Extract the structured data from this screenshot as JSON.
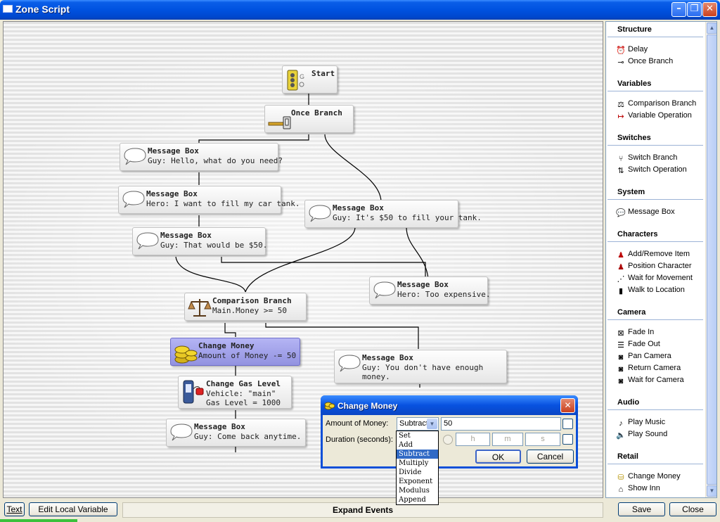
{
  "window": {
    "title": "Zone Script",
    "controls": [
      "minimize-icon",
      "restore-icon",
      "close-icon"
    ]
  },
  "nodes": [
    {
      "id": "start",
      "title": "Start",
      "desc": "",
      "icon": "traffic-light-icon"
    },
    {
      "id": "once",
      "title": "Once Branch",
      "desc": "",
      "icon": "key-icon"
    },
    {
      "id": "msg1",
      "title": "Message Box",
      "desc": "Guy: Hello, what do you need?",
      "icon": "speech-bubble-icon"
    },
    {
      "id": "msg2",
      "title": "Message Box",
      "desc": "Hero: I want to fill my car tank.",
      "icon": "speech-bubble-icon"
    },
    {
      "id": "msg3",
      "title": "Message Box",
      "desc": "Guy: That would be $50.",
      "icon": "speech-bubble-icon"
    },
    {
      "id": "msg4",
      "title": "Message Box",
      "desc": "Guy: It's $50 to fill your tank.",
      "icon": "speech-bubble-icon"
    },
    {
      "id": "msg5",
      "title": "Message Box",
      "desc": "Hero: Too expensive.",
      "icon": "speech-bubble-icon"
    },
    {
      "id": "cmp",
      "title": "Comparison Branch",
      "desc": "Main.Money >= 50",
      "icon": "scale-icon"
    },
    {
      "id": "money",
      "title": "Change Money",
      "desc": "Amount of Money -= 50",
      "icon": "coins-icon"
    },
    {
      "id": "gas",
      "title": "Change Gas Level",
      "desc": "Vehicle: \"main\"\nGas Level = 1000",
      "icon": "gas-pump-icon"
    },
    {
      "id": "msg6",
      "title": "Message Box",
      "desc": "Guy: Come back anytime.",
      "icon": "speech-bubble-icon"
    },
    {
      "id": "msg7",
      "title": "Message Box",
      "desc": "Guy: You don't have enough\nmoney.",
      "icon": "speech-bubble-icon"
    }
  ],
  "panel": {
    "sections": [
      {
        "header": "Structure",
        "items": [
          {
            "label": "Delay",
            "icon": "alarm-clock-icon"
          },
          {
            "label": "Once Branch",
            "icon": "key-icon"
          }
        ]
      },
      {
        "header": "Variables",
        "items": [
          {
            "label": "Comparison Branch",
            "icon": "scale-icon"
          },
          {
            "label": "Variable Operation",
            "icon": "arrow-operation-icon"
          }
        ]
      },
      {
        "header": "Switches",
        "items": [
          {
            "label": "Switch Branch",
            "icon": "switch-branch-icon"
          },
          {
            "label": "Switch Operation",
            "icon": "switch-operation-icon"
          }
        ]
      },
      {
        "header": "System",
        "items": [
          {
            "label": "Message Box",
            "icon": "speech-bubble-icon"
          }
        ]
      },
      {
        "header": "Characters",
        "items": [
          {
            "label": "Add/Remove Item",
            "icon": "add-remove-item-icon"
          },
          {
            "label": "Position Character",
            "icon": "position-character-icon"
          },
          {
            "label": "Wait for Movement",
            "icon": "wait-movement-icon"
          },
          {
            "label": "Walk to Location",
            "icon": "walk-location-icon"
          }
        ]
      },
      {
        "header": "Camera",
        "items": [
          {
            "label": "Fade In",
            "icon": "fade-in-icon"
          },
          {
            "label": "Fade Out",
            "icon": "fade-out-icon"
          },
          {
            "label": "Pan Camera",
            "icon": "pan-camera-icon"
          },
          {
            "label": "Return Camera",
            "icon": "return-camera-icon"
          },
          {
            "label": "Wait for Camera",
            "icon": "wait-camera-icon"
          }
        ]
      },
      {
        "header": "Audio",
        "items": [
          {
            "label": "Play Music",
            "icon": "music-note-icon"
          },
          {
            "label": "Play Sound",
            "icon": "speaker-icon"
          }
        ]
      },
      {
        "header": "Retail",
        "items": [
          {
            "label": "Change Money",
            "icon": "coins-icon"
          },
          {
            "label": "Show Inn",
            "icon": "inn-icon"
          }
        ]
      }
    ]
  },
  "bottom": {
    "text_btn": "Text",
    "edit_var": "Edit Local Variable",
    "expand": "Expand Events",
    "save": "Save",
    "close": "Close"
  },
  "dialog": {
    "title": "Change Money",
    "amount_label": "Amount of Money:",
    "operation": "Subtract",
    "amount_value": "50",
    "duration_label": "Duration (seconds):",
    "h": "h",
    "m": "m",
    "s": "s",
    "ok": "OK",
    "cancel": "Cancel",
    "options": [
      "Set",
      "Add",
      "Subtract",
      "Multiply",
      "Divide",
      "Exponent",
      "Modulus",
      "Append"
    ],
    "selected_option": "Subtract"
  },
  "colors": {
    "titlebar": "#0052e0",
    "selected_node": "#9f9fe8",
    "highlight": "#316ac5"
  }
}
